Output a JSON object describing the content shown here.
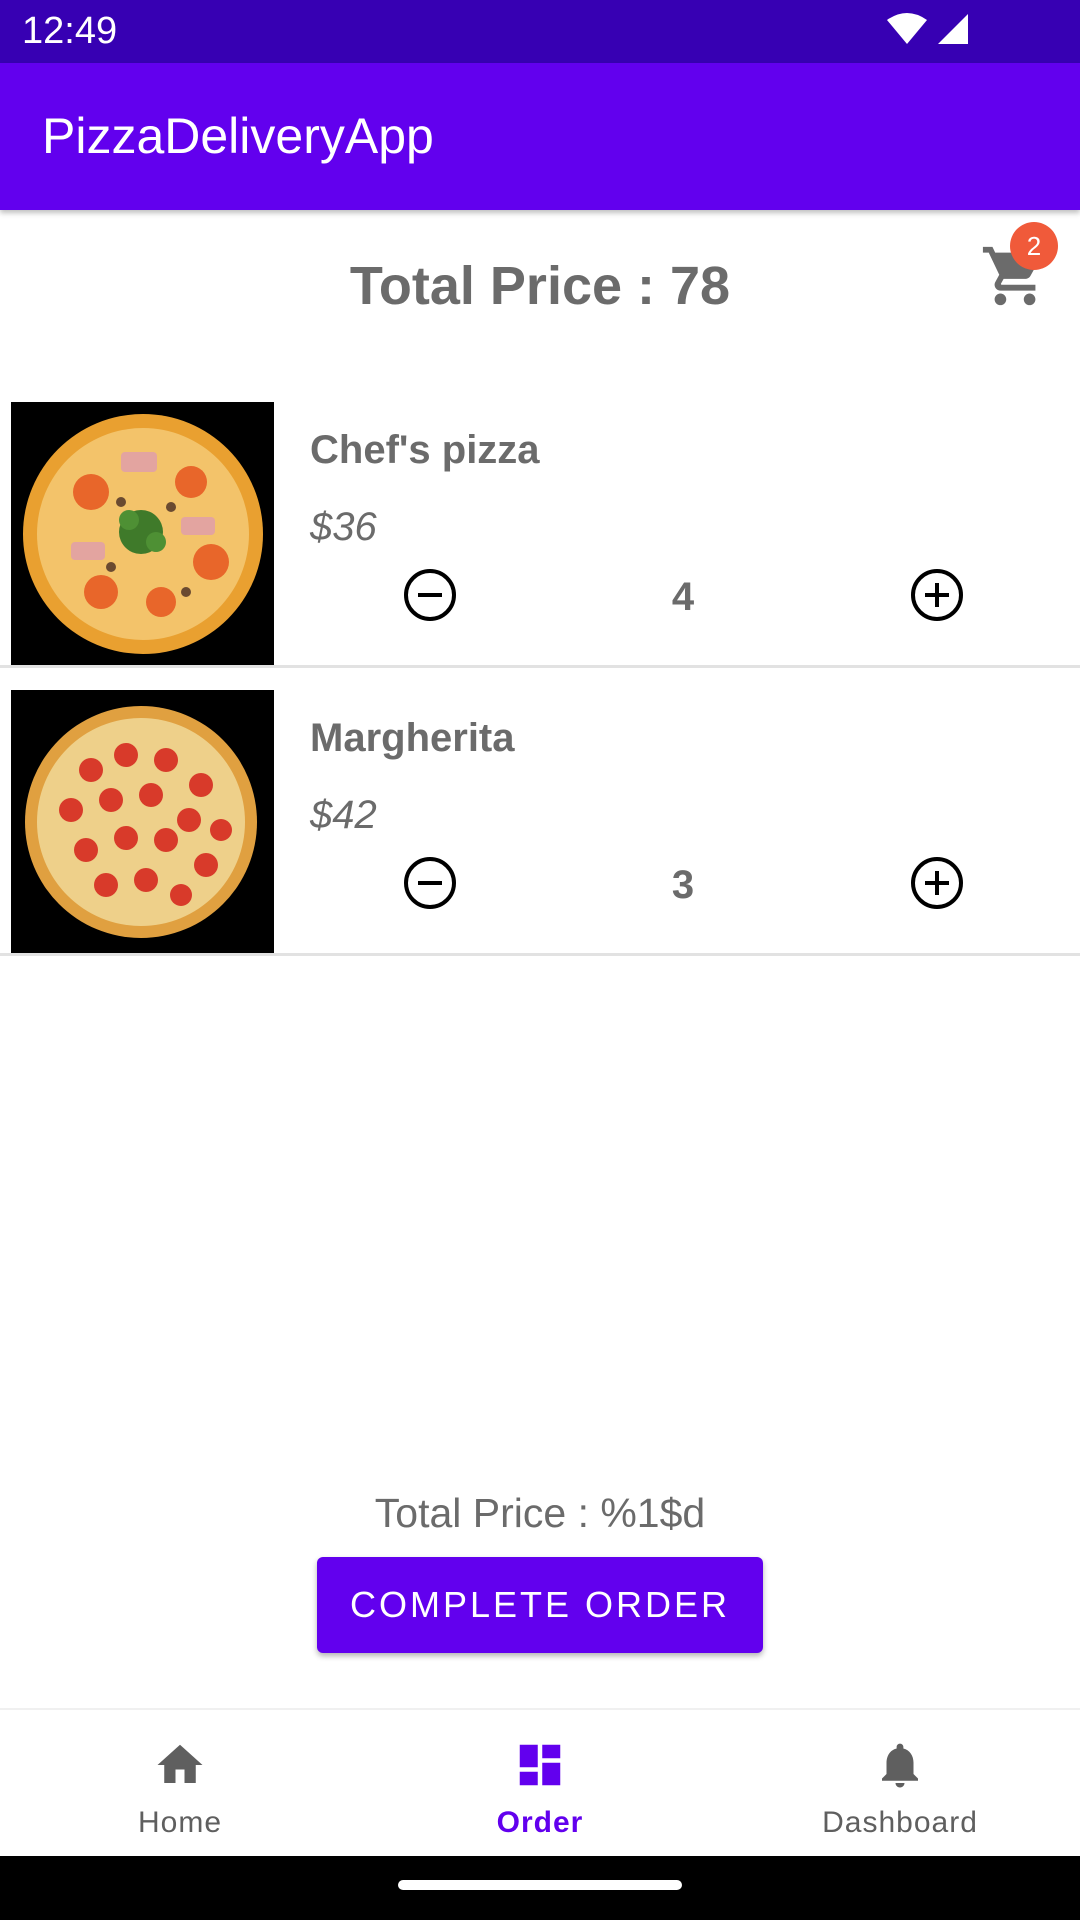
{
  "status_bar": {
    "time": "12:49"
  },
  "app_bar": {
    "title": "PizzaDeliveryApp"
  },
  "header": {
    "total_price": "Total Price : 78",
    "cart_badge_count": "2"
  },
  "items": [
    {
      "name": "Chef's pizza",
      "price": "$36",
      "quantity": "4"
    },
    {
      "name": "Margherita",
      "price": "$42",
      "quantity": "3"
    }
  ],
  "footer": {
    "total_price": "Total Price : %1$d",
    "complete_button": "COMPLETE ORDER"
  },
  "bottom_nav": [
    {
      "label": "Home",
      "icon": "home-icon",
      "active": false
    },
    {
      "label": "Order",
      "icon": "order-dashboard-icon",
      "active": true
    },
    {
      "label": "Dashboard",
      "icon": "notification-bell-icon",
      "active": false
    }
  ],
  "colors": {
    "primary": "#6200ee",
    "primary_dark": "#3700b3",
    "badge": "#f05a3a",
    "text_gray": "#6b6b6b"
  }
}
